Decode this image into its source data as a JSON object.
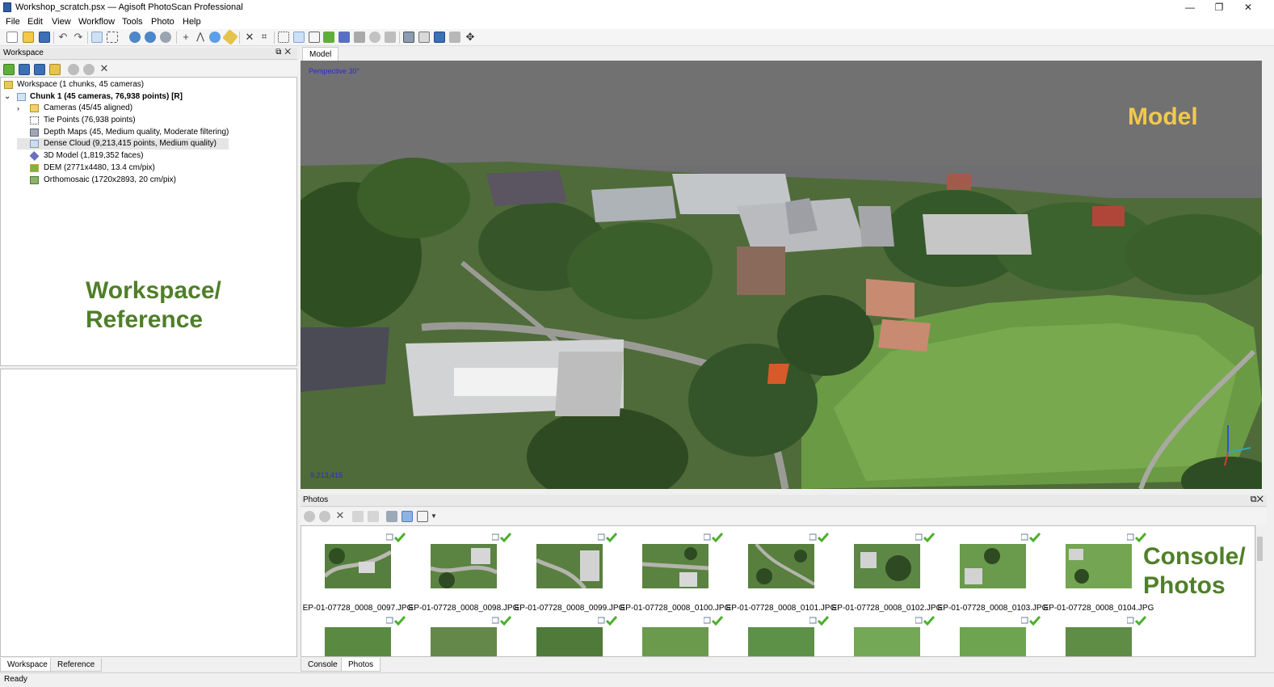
{
  "window": {
    "title": "Workshop_scratch.psx — Agisoft PhotoScan Professional",
    "controls": {
      "minimize": "—",
      "restore": "❐",
      "close": "✕"
    }
  },
  "menu": [
    "File",
    "Edit",
    "View",
    "Workflow",
    "Tools",
    "Photo",
    "Help"
  ],
  "workspace_panel": {
    "title": "Workspace",
    "tree": {
      "root": "Workspace (1 chunks, 45 cameras)",
      "chunk": "Chunk 1 (45 cameras, 76,938 points) [R]",
      "items": [
        {
          "label": "Cameras (45/45 aligned)",
          "icon": "folder-icon"
        },
        {
          "label": "Tie Points (76,938 points)",
          "icon": "tie-points-icon"
        },
        {
          "label": "Depth Maps (45, Medium quality, Moderate filtering)",
          "icon": "depth-maps-icon"
        },
        {
          "label": "Dense Cloud (9,213,415 points, Medium quality)",
          "icon": "dense-cloud-icon",
          "selected": true
        },
        {
          "label": "3D Model (1,819,352 faces)",
          "icon": "model-icon"
        },
        {
          "label": "DEM (2771x4480, 13.4 cm/pix)",
          "icon": "dem-icon"
        },
        {
          "label": "Orthomosaic (1720x2893, 20 cm/pix)",
          "icon": "orthomosaic-icon"
        }
      ]
    },
    "callout_line1": "Workspace/",
    "callout_line2": "Reference",
    "tabs": [
      "Workspace",
      "Reference"
    ]
  },
  "model_panel": {
    "tab": "Model",
    "view_label": "Perspective 30°",
    "callout": "Model",
    "point_count": "9,213,415"
  },
  "photos_panel": {
    "title": "Photos",
    "callout_line1": "Console/",
    "callout_line2": "Photos",
    "row1": [
      "EP-01-07728_0008_0097.JPG",
      "EP-01-07728_0008_0098.JPG",
      "EP-01-07728_0008_0099.JPG",
      "EP-01-07728_0008_0100.JPG",
      "EP-01-07728_0008_0101.JPG",
      "EP-01-07728_0008_0102.JPG",
      "EP-01-07728_0008_0103.JPG",
      "EP-01-07728_0008_0104.JPG"
    ],
    "tabs": [
      "Console",
      "Photos"
    ]
  },
  "status": {
    "text": "Ready"
  },
  "colors": {
    "workspace_callout": "#4f7f2a",
    "model_callout": "#f2c94c",
    "photos_callout": "#4f7f2a",
    "view_label": "#2a2ad8"
  }
}
